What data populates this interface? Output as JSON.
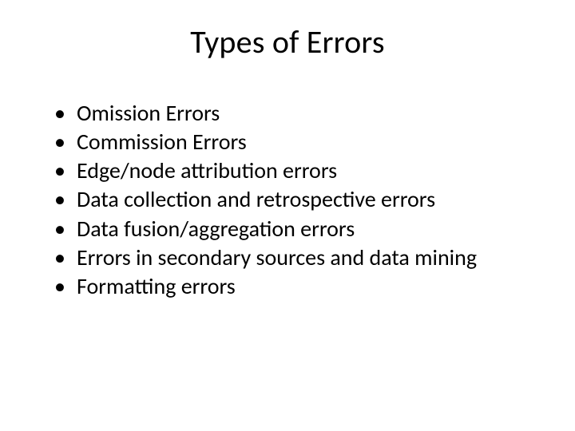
{
  "slide": {
    "title": "Types of Errors",
    "bullets": [
      "Omission Errors",
      "Commission Errors",
      "Edge/node attribution errors",
      "Data collection and retrospective errors",
      "Data fusion/aggregation errors",
      "Errors in secondary sources and data mining",
      "Formatting errors"
    ]
  }
}
